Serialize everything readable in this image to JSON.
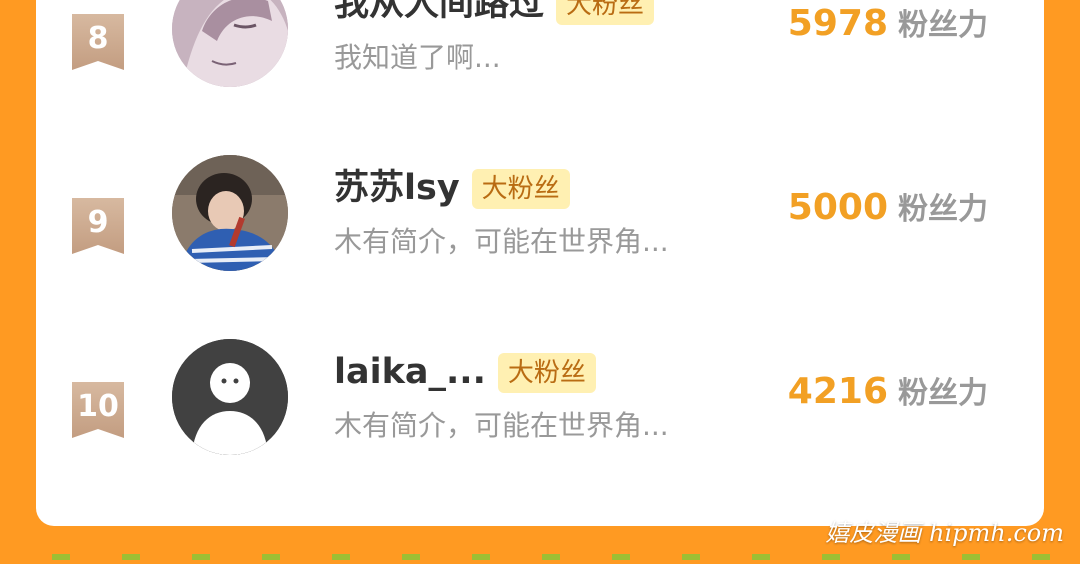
{
  "rows": [
    {
      "rank": "8",
      "name": "我从人间路过",
      "badge": "大粉丝",
      "desc": "我知道了啊...",
      "score": "5978",
      "unit": "粉丝力",
      "avatar": "anime-character-avatar"
    },
    {
      "rank": "9",
      "name": "苏苏lsy",
      "badge": "大粉丝",
      "desc": "木有简介，可能在世界角...",
      "score": "5000",
      "unit": "粉丝力",
      "avatar": "photo-avatar"
    },
    {
      "rank": "10",
      "name": "laika_...",
      "badge": "大粉丝",
      "desc": "木有简介，可能在世界角...",
      "score": "4216",
      "unit": "粉丝力",
      "avatar": "default-avatar"
    }
  ],
  "watermark": "嬉皮漫画 hipmh.com",
  "colors": {
    "background": "#FF9A22",
    "score": "#F2A024",
    "badge_bg": "#FFF0B2"
  }
}
